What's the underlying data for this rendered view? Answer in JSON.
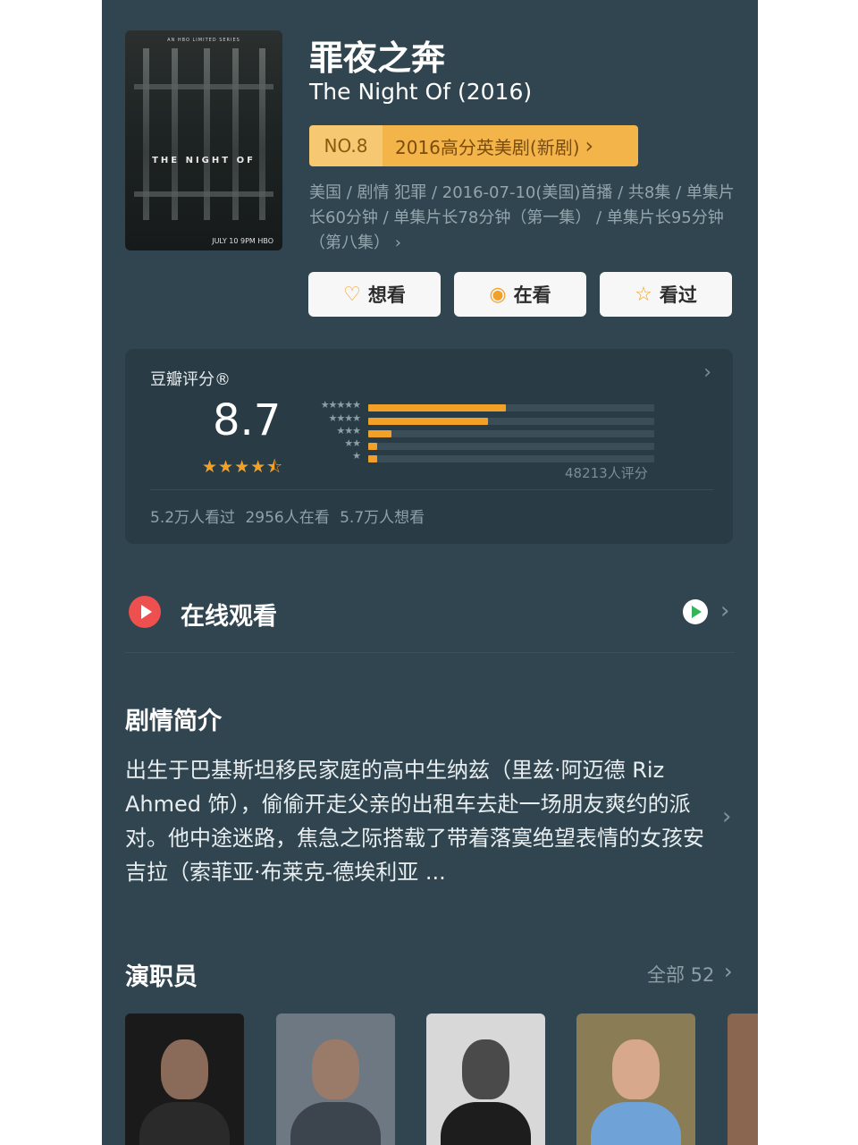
{
  "title_cn": "罪夜之奔",
  "title_en": "The Night Of (2016)",
  "rank": {
    "no": "NO.8",
    "text": "2016高分英美剧(新剧)",
    "chevron": "›"
  },
  "meta": "美国 / 剧情 犯罪 / 2016-07-10(美国)首播 / 共8集 / 单集片长60分钟 / 单集片长78分钟（第一集） / 单集片长95分钟（第八集） ›",
  "poster": {
    "top": "AN HBO LIMITED SERIES",
    "title": "THE NIGHT OF",
    "bottom": "JULY 10 9PM HBO"
  },
  "actions": [
    {
      "label": "想看",
      "icon": "heart-plus-icon",
      "glyph": "♡"
    },
    {
      "label": "在看",
      "icon": "dot-circle-icon",
      "glyph": "◉"
    },
    {
      "label": "看过",
      "icon": "star-outline-icon",
      "glyph": "☆"
    }
  ],
  "rating": {
    "label": "豆瓣评分®",
    "chevron": "›",
    "score": "8.7",
    "stars_text": "★★★★⯪",
    "star_labels": [
      "★★★★★",
      "★★★★",
      "★★★",
      "★★",
      "★"
    ],
    "distribution": [
      0.48,
      0.42,
      0.08,
      0.02,
      0.01
    ],
    "count": "48213人评分",
    "watch_stats": "5.2万人看过  2956人在看  5.7万人想看"
  },
  "online": {
    "label": "在线观看",
    "chevron": "›"
  },
  "synopsis": {
    "title": "剧情简介",
    "text": "出生于巴基斯坦移民家庭的高中生纳兹（里兹·阿迈德 Riz Ahmed 饰），偷偷开走父亲的出租车去赴一场朋友爽约的派对。他中途迷路，焦急之际搭载了带着落寞绝望表情的女孩安吉拉（索菲亚·布莱克-德埃利亚 ...",
    "chevron": "›"
  },
  "cast": {
    "title": "演职员",
    "all": "全部 52",
    "chevron": "›"
  },
  "colors": {
    "background": "#30454f",
    "accent": "#f2a128",
    "card": "#293b44",
    "red": "#ee4f4f"
  }
}
